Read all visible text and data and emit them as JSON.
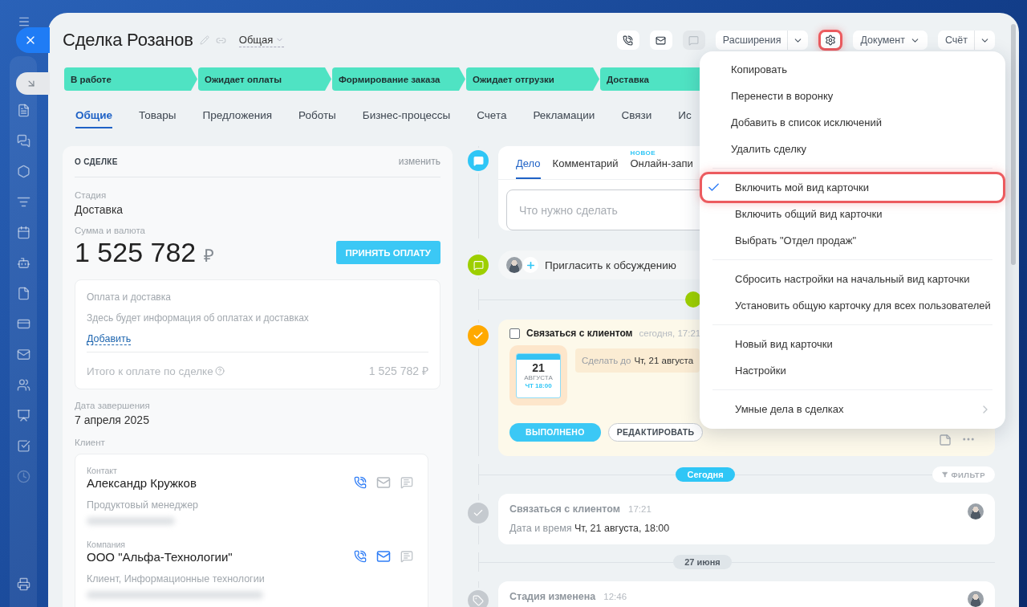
{
  "header": {
    "title": "Сделка Розанов",
    "category": "Общая"
  },
  "toolbar": {
    "icon_buttons": [
      {
        "kind": "phone",
        "disabled": false
      },
      {
        "kind": "mail",
        "disabled": false
      },
      {
        "kind": "chat",
        "disabled": true
      }
    ],
    "extensions": "Расширения",
    "settings_highlighted": true,
    "document": "Документ",
    "invoice": "Счёт"
  },
  "stages": [
    {
      "label": "В работе"
    },
    {
      "label": "Ожидает оплаты"
    },
    {
      "label": "Формирование заказа"
    },
    {
      "label": "Ожидает отгрузки"
    },
    {
      "label": "Доставка"
    }
  ],
  "tabs": [
    {
      "label": "Общие",
      "selected": true
    },
    {
      "label": "Товары",
      "selected": false
    },
    {
      "label": "Предложения",
      "selected": false
    },
    {
      "label": "Роботы",
      "selected": false
    },
    {
      "label": "Бизнес-процессы",
      "selected": false
    },
    {
      "label": "Счета",
      "selected": false
    },
    {
      "label": "Рекламации",
      "selected": false
    },
    {
      "label": "Связи",
      "selected": false
    },
    {
      "label": "Ис",
      "selected": false
    }
  ],
  "deal": {
    "title": "О СДЕЛКЕ",
    "edit": "изменить",
    "stage_label": "Стадия",
    "stage": "Доставка",
    "amount_label": "Сумма и валюта",
    "amount": "1 525 782",
    "currency": "₽",
    "pay_button": "ПРИНЯТЬ ОПЛАТУ",
    "payments": {
      "title": "Оплата и доставка",
      "hint": "Здесь будет информация об оплатах и доставках",
      "add": "Добавить",
      "total_label": "Итого к оплате по сделке",
      "total": "1 525 782 ₽"
    },
    "close_date_label": "Дата завершения",
    "close_date": "7 апреля 2025",
    "client_label": "Клиент",
    "clients": [
      {
        "type": "Контакт",
        "name": "Александр Кружков",
        "role": "Продуктовый менеджер",
        "email_active": false
      },
      {
        "type": "Компания",
        "name": "ООО \"Альфа-Технологии\"",
        "role": "Клиент, Информационные технологии",
        "email_active": true
      }
    ]
  },
  "timeline": {
    "composer": {
      "tabs": [
        {
          "label": "Дело",
          "selected": true
        },
        {
          "label": "Комментарий",
          "selected": false
        },
        {
          "label": "Онлайн-запи",
          "selected": false,
          "badge": "НОВОЕ"
        }
      ],
      "placeholder": "Что нужно сделать"
    },
    "invite": "Пригласить к обсуждению",
    "task": {
      "checked": false,
      "title": "Связаться с клиентом",
      "time": "сегодня, 17:21",
      "day": "21",
      "month": "АВГУСТА",
      "weekday_time": "ЧТ 18:00",
      "deadline_label": "Сделать до",
      "deadline": "Чт, 21 августа",
      "done_button": "ВЫПОЛНЕНО",
      "edit_button": "РЕДАКТИРОВАТЬ"
    },
    "today": "Сегодня",
    "filter": "ФИЛЬТР",
    "today_events": [
      {
        "kind": "done",
        "title": "Связаться с клиентом",
        "time": "17:21",
        "detail_label": "Дата и время",
        "detail": "Чт, 21 августа, 18:00"
      }
    ],
    "date": "27 июня",
    "earlier_events": [
      {
        "kind": "stage",
        "title": "Стадия изменена",
        "time": "12:46"
      }
    ]
  },
  "menu": {
    "sections": [
      {
        "checkable": false,
        "items": [
          {
            "label": "Копировать",
            "checked": false,
            "highlighted": false,
            "submenu": false
          },
          {
            "label": "Перенести в воронку",
            "checked": false,
            "highlighted": false,
            "submenu": false
          },
          {
            "label": "Добавить в список исключений",
            "checked": false,
            "highlighted": false,
            "submenu": false
          },
          {
            "label": "Удалить сделку",
            "checked": false,
            "highlighted": false,
            "submenu": false
          }
        ]
      },
      {
        "checkable": true,
        "items": [
          {
            "label": "Включить мой вид карточки",
            "checked": true,
            "highlighted": true,
            "submenu": false
          },
          {
            "label": "Включить общий вид карточки",
            "checked": false,
            "highlighted": false,
            "submenu": false
          },
          {
            "label": "Выбрать \"Отдел продаж\"",
            "checked": false,
            "highlighted": false,
            "submenu": false
          }
        ]
      },
      {
        "checkable": true,
        "items": [
          {
            "label": "Сбросить настройки на начальный вид карточки",
            "checked": false,
            "highlighted": false,
            "submenu": false
          },
          {
            "label": "Установить общую карточку для всех пользователей",
            "checked": false,
            "highlighted": false,
            "submenu": false
          }
        ]
      },
      {
        "checkable": true,
        "items": [
          {
            "label": "Новый вид карточки",
            "checked": false,
            "highlighted": false,
            "submenu": false
          },
          {
            "label": "Настройки",
            "checked": false,
            "highlighted": false,
            "submenu": false
          }
        ]
      },
      {
        "checkable": true,
        "items": [
          {
            "label": "Умные дела в сделках",
            "checked": false,
            "highlighted": false,
            "submenu": true
          }
        ]
      }
    ]
  }
}
